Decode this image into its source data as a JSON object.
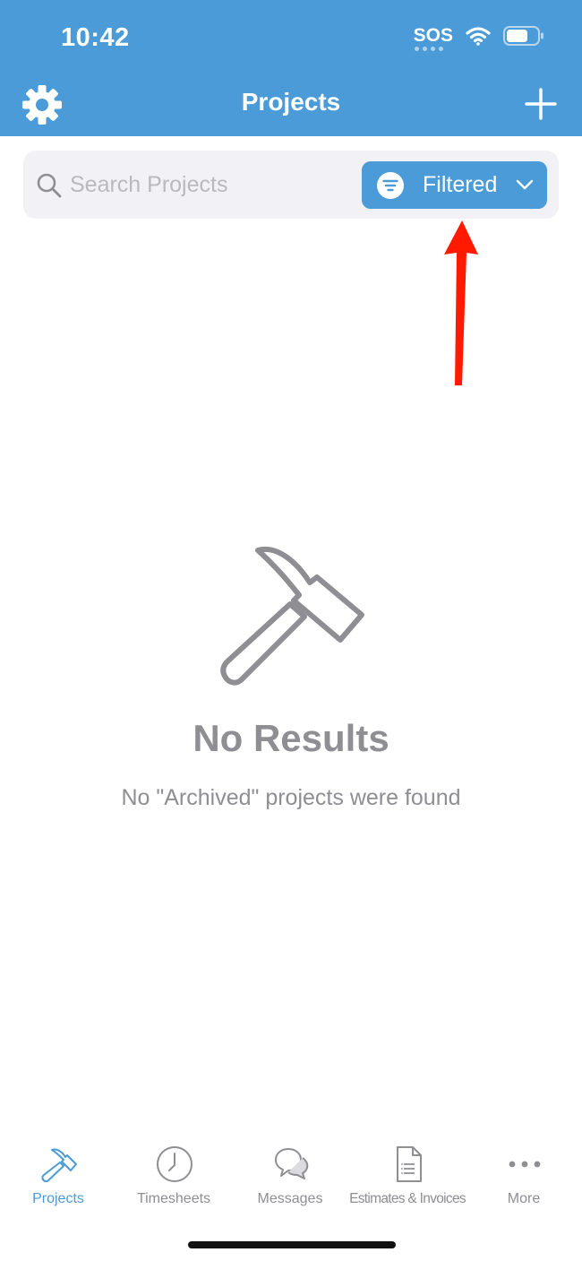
{
  "status_bar": {
    "time": "10:42",
    "carrier": "SOS",
    "icons": [
      "wifi-icon",
      "battery-icon"
    ]
  },
  "nav": {
    "title": "Projects",
    "left_icon": "gear-icon",
    "right_icon": "plus-icon"
  },
  "search": {
    "placeholder": "Search Projects",
    "value": ""
  },
  "filter": {
    "label": "Filtered",
    "icon": "filter-icon",
    "chevron": "chevron-down-icon"
  },
  "empty_state": {
    "icon": "hammer-icon",
    "title": "No Results",
    "message": "No \"Archived\" projects were found"
  },
  "tabs": [
    {
      "label": "Projects",
      "icon": "hammer-icon",
      "active": true
    },
    {
      "label": "Timesheets",
      "icon": "clock-icon",
      "active": false
    },
    {
      "label": "Messages",
      "icon": "chat-bubbles-icon",
      "active": false
    },
    {
      "label": "Estimates & Invoices",
      "icon": "document-icon",
      "active": false
    },
    {
      "label": "More",
      "icon": "more-icon",
      "active": false
    }
  ],
  "colors": {
    "primary": "#4a9bd7",
    "muted": "#8e8e93",
    "search_bg": "#f1f1f6",
    "annotation": "#ff1a00"
  }
}
